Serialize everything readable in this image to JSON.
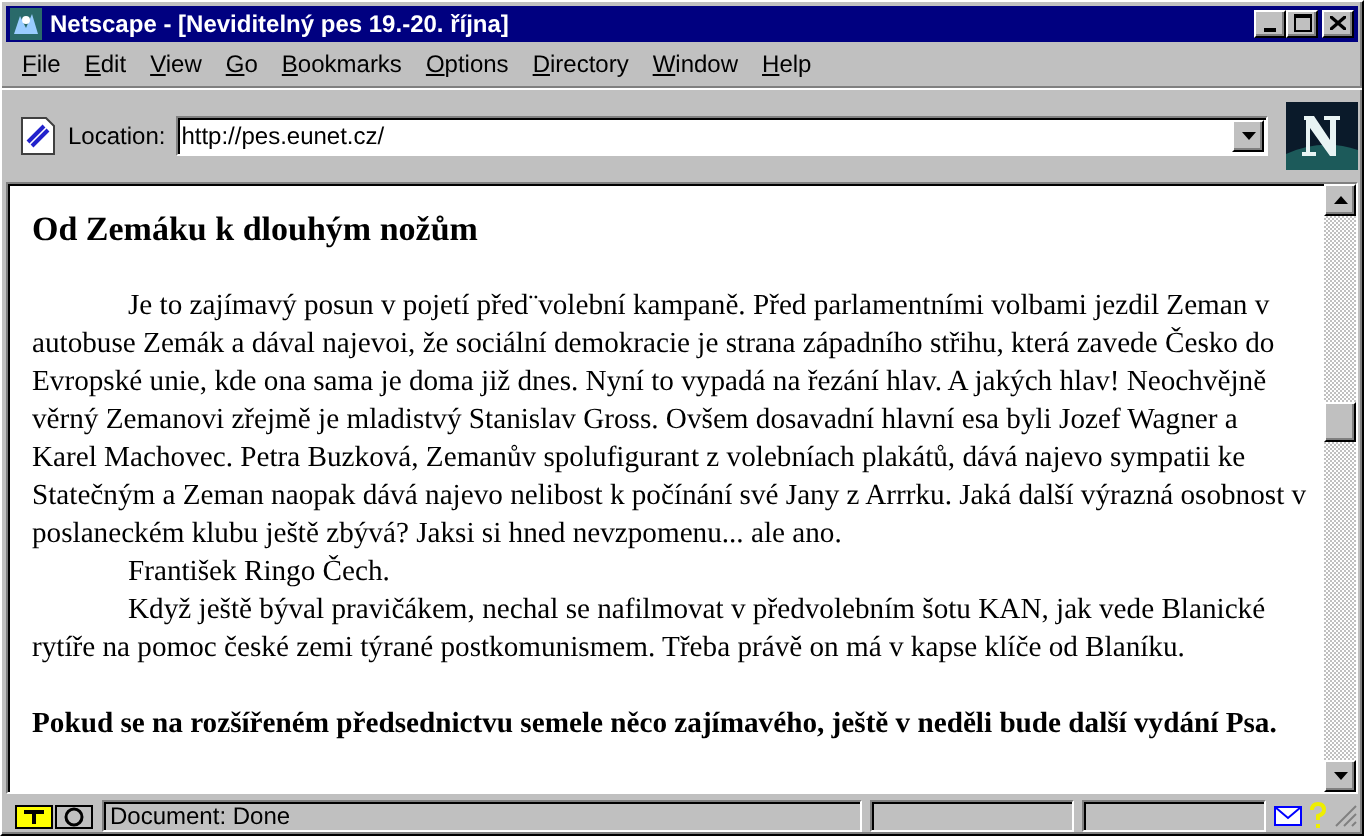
{
  "window": {
    "title": "Netscape - [Neviditelný pes 19.-20. října]"
  },
  "menu": [
    {
      "label": "File"
    },
    {
      "label": "Edit"
    },
    {
      "label": "View"
    },
    {
      "label": "Go"
    },
    {
      "label": "Bookmarks"
    },
    {
      "label": "Options"
    },
    {
      "label": "Directory"
    },
    {
      "label": "Window"
    },
    {
      "label": "Help"
    }
  ],
  "location": {
    "label": "Location:",
    "value": "http://pes.eunet.cz/"
  },
  "article": {
    "heading": "Od Zemáku k dlouhým nožům",
    "paragraphs": [
      {
        "kind": "indented",
        "text": "Je to zajímavý posun v pojetí před¨volební kampaně. Před parlamentními volbami jezdil Zeman v autobuse Zemák a dával najevoi, že sociální demokracie je strana západního střihu, která zavede Česko do Evropské unie, kde ona sama je doma již dnes. Nyní to vypadá na řezání hlav. A jakých hlav! Neochvějně věrný Zemanovi zřejmě je mladistvý Stanislav Gross. Ovšem dosavadní hlavní esa byli Jozef Wagner a Karel Machovec. Petra Buzková, Zemanův spolufigurant z volebníach plakátů, dává najevo sympatii ke Statečným a Zeman naopak dává najevo nelibost k počínání své Jany z Arrrku. Jaká další výrazná osobnost v poslaneckém klubu ještě zbývá? Jaksi si hned nevzpomenu... ale ano."
      },
      {
        "kind": "indented",
        "text": "František Ringo Čech."
      },
      {
        "kind": "indented",
        "text": "Když ještě býval pravičákem, nechal se nafilmovat v předvolebním šotu KAN, jak vede Blanické rytíře na pomoc české zemi týrané postkomunismem. Třeba právě on má v kapse klíče od Blaníku."
      },
      {
        "kind": "bold",
        "text": "Pokud se na rozšířeném předsednictvu semele něco zajímavého, ještě v neděli bude další vydání Psa."
      }
    ]
  },
  "status_bar": {
    "text": "Document: Done"
  }
}
